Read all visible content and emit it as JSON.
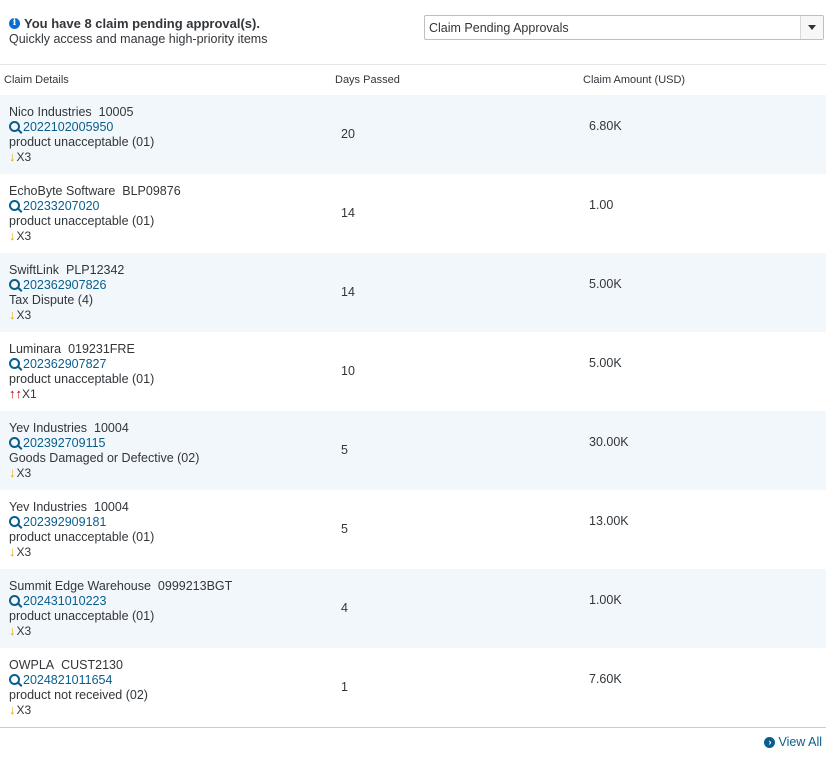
{
  "header": {
    "title": "You have 8 claim pending approval(s).",
    "subtitle": "Quickly access and manage high-priority items"
  },
  "select": {
    "value": "Claim Pending Approvals"
  },
  "table": {
    "columns": [
      "Claim Details",
      "Days Passed",
      "Claim Amount (USD)"
    ],
    "rows": [
      {
        "company": "Nico Industries",
        "code": "10005",
        "claim_no": "2022102005950",
        "reason": "product unacceptable (01)",
        "priority": "X3",
        "days": "20",
        "amount": "6.80K"
      },
      {
        "company": "EchoByte Software",
        "code": "BLP09876",
        "claim_no": "20233207020",
        "reason": "product unacceptable (01)",
        "priority": "X3",
        "days": "14",
        "amount": "1.00"
      },
      {
        "company": "SwiftLink",
        "code": "PLP12342",
        "claim_no": "202362907826",
        "reason": "Tax Dispute (4)",
        "priority": "X3",
        "days": "14",
        "amount": "5.00K"
      },
      {
        "company": "Luminara",
        "code": "019231FRE",
        "claim_no": "202362907827",
        "reason": "product unacceptable (01)",
        "priority": "X1",
        "days": "10",
        "amount": "5.00K"
      },
      {
        "company": "Yev Industries",
        "code": "10004",
        "claim_no": "202392709115",
        "reason": "Goods Damaged or Defective (02)",
        "priority": "X3",
        "days": "5",
        "amount": "30.00K"
      },
      {
        "company": "Yev Industries",
        "code": "10004",
        "claim_no": "202392909181",
        "reason": "product unacceptable (01)",
        "priority": "X3",
        "days": "5",
        "amount": "13.00K"
      },
      {
        "company": "Summit Edge Warehouse",
        "code": "0999213BGT",
        "claim_no": "202431010223",
        "reason": "product unacceptable (01)",
        "priority": "X3",
        "days": "4",
        "amount": "1.00K"
      },
      {
        "company": "OWPLA",
        "code": "CUST2130",
        "claim_no": "2024821011654",
        "reason": "product not received (02)",
        "priority": "X3",
        "days": "1",
        "amount": "7.60K"
      }
    ]
  },
  "footer": {
    "view_all": "View All"
  }
}
